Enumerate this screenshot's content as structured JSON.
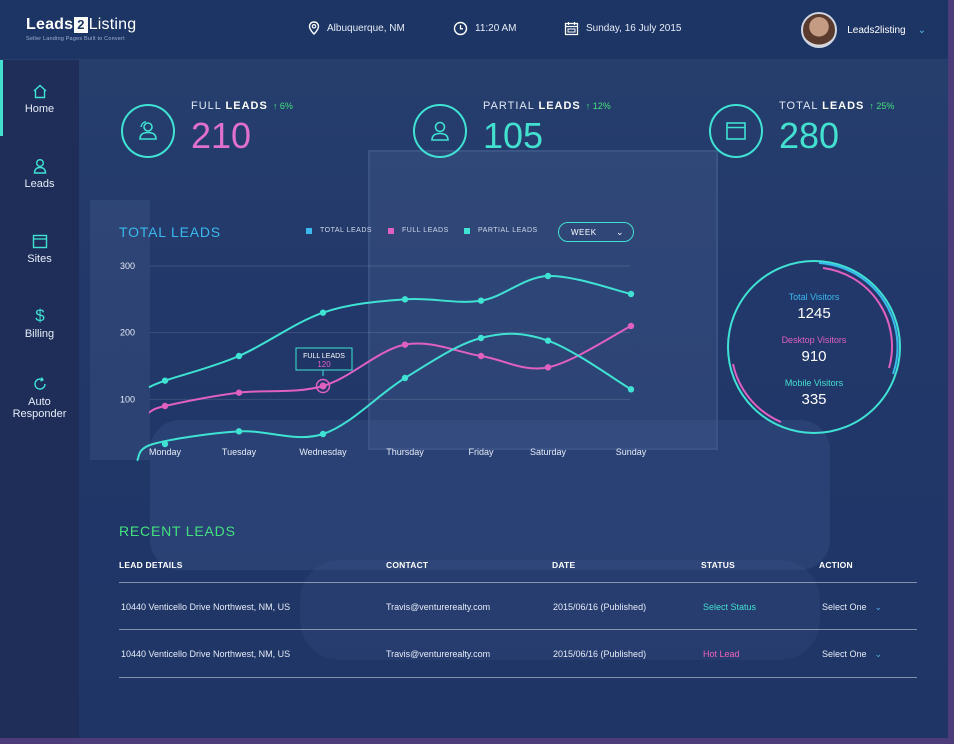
{
  "header": {
    "brand_a": "Leads",
    "brand_b": "2",
    "brand_c": "Listing",
    "tagline": "Seller Landing Pages Built to Convert",
    "location": "Albuquerque, NM",
    "time": "11:20 AM",
    "date": "Sunday, 16 July 2015",
    "username": "Leads2listing"
  },
  "sidebar": {
    "items": [
      {
        "label": "Home",
        "icon": "home-icon"
      },
      {
        "label": "Leads",
        "icon": "user-icon"
      },
      {
        "label": "Sites",
        "icon": "browser-icon"
      },
      {
        "label": "Billing",
        "icon": "dollar-icon"
      },
      {
        "label_1": "Auto",
        "label_2": "Responder",
        "icon": "refresh-icon"
      }
    ]
  },
  "stats": [
    {
      "label_a": "FULL ",
      "label_b": "LEADS",
      "change": "6%",
      "value": "210",
      "color": "#e06fd0"
    },
    {
      "label_a": "PARTIAL ",
      "label_b": "LEADS",
      "change": "12%",
      "value": "105",
      "color": "#43e0d0"
    },
    {
      "label_a": "TOTAL ",
      "label_b": "LEADS",
      "change": "25%",
      "value": "280",
      "color": "#43e0d0"
    }
  ],
  "chart": {
    "title": "TOTAL LEADS",
    "legend": [
      "TOTAL LEADS",
      "FULL LEADS",
      "PARTIAL LEADS"
    ],
    "period": "WEEK",
    "tooltip_label": "FULL LEADS",
    "tooltip_value": "120"
  },
  "chart_data": {
    "type": "line",
    "title": "TOTAL LEADS",
    "categories": [
      "Monday",
      "Tuesday",
      "Wednesday",
      "Thursday",
      "Friday",
      "Saturday",
      "Sunday"
    ],
    "y_ticks": [
      "300",
      "200",
      "100"
    ],
    "ylim": [
      0,
      300
    ],
    "series": [
      {
        "name": "TOTAL LEADS",
        "color": "#3fe2d3",
        "x": [
          "Monday",
          "Tuesday",
          "Wednesday",
          "Thursday",
          "Friday",
          "Saturday",
          "Sunday"
        ],
        "values": [
          128,
          165,
          230,
          250,
          248,
          285,
          258
        ]
      },
      {
        "name": "FULL LEADS",
        "color": "#e060c0",
        "x": [
          "Monday",
          "Tuesday",
          "Wednesday",
          "Thursday",
          "Friday",
          "Saturday",
          "Sunday"
        ],
        "values": [
          90,
          110,
          120,
          182,
          165,
          148,
          210
        ]
      },
      {
        "name": "PARTIAL LEADS",
        "color": "#3fe2d3",
        "x": [
          "Monday",
          "Tuesday",
          "Wednesday",
          "Thursday",
          "Friday",
          "Saturday",
          "Sunday"
        ],
        "values": [
          33,
          52,
          48,
          132,
          192,
          188,
          115
        ]
      }
    ],
    "grid": true,
    "legend_position": "top"
  },
  "visitors": {
    "total_label": "Total Visitors",
    "total_value": "1245",
    "desktop_label": "Desktop Visitors",
    "desktop_value": "910",
    "mobile_label": "Mobile Visitors",
    "mobile_value": "335",
    "total_color": "#3ab8ef",
    "desktop_color": "#e060c0",
    "mobile_color": "#43e0d0"
  },
  "recent": {
    "title": "RECENT LEADS",
    "headers": [
      "LEAD DETAILS",
      "CONTACT",
      "DATE",
      "STATUS",
      "ACTION"
    ],
    "rows": [
      {
        "details": "10440 Venticello Drive Northwest, NM, US",
        "contact": "Travis@venturerealty.com",
        "date": "2015/06/16 (Published)",
        "status": "Select Status",
        "action": "Select One"
      },
      {
        "details": "10440 Venticello Drive Northwest, NM, US",
        "contact": "Travis@venturerealty.com",
        "date": "2015/06/16 (Published)",
        "status": "Hot Lead",
        "action": "Select One"
      }
    ]
  }
}
